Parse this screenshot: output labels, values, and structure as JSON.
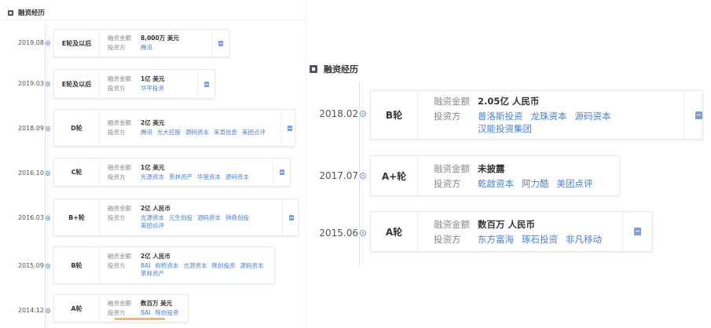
{
  "left": {
    "section_title": "融资经历",
    "rounds": [
      {
        "date": "2019.08",
        "stage": "E轮及以后",
        "amount_label": "融资金额",
        "amount": "8,000万 美元",
        "investor_label": "投资方",
        "investors": [
          "腾讯"
        ]
      },
      {
        "date": "2019.03",
        "stage": "E轮及以后",
        "amount_label": "融资金额",
        "amount": "1亿 美元",
        "investor_label": "投资方",
        "investors": [
          "华平投资"
        ]
      },
      {
        "date": "2018.09",
        "stage": "D轮",
        "amount_label": "融资金额",
        "amount": "2亿 美元",
        "investor_label": "投资方",
        "investors": [
          "腾讯",
          "光大控股",
          "源码资本",
          "来肯信息",
          "美团点评"
        ]
      },
      {
        "date": "2016.10",
        "stage": "C轮",
        "amount_label": "融资金额",
        "amount": "1亿 美元",
        "investor_label": "投资方",
        "investors": [
          "光源资本",
          "景林资产",
          "华登资本",
          "源码资本"
        ]
      },
      {
        "date": "2016.03",
        "stage": "B+轮",
        "amount_label": "融资金额",
        "amount": "2亿 人民币",
        "investor_label": "投资方",
        "investors": [
          "光源资本",
          "元生创投",
          "源码资本",
          "钟鼎创投",
          "美团点评"
        ]
      },
      {
        "date": "2015.09",
        "stage": "B轮",
        "amount_label": "融资金额",
        "amount": "2亿 人民币",
        "investor_label": "投资方",
        "investors": [
          "BAI",
          "树桥资本",
          "光源资本",
          "降创投资",
          "源码资本",
          "景林资产"
        ]
      },
      {
        "date": "2014.12",
        "stage": "A轮",
        "amount_label": "融资金额",
        "amount": "数百万 美元",
        "investor_label": "投资方",
        "investors": [
          "BAI",
          "降创投资"
        ]
      }
    ]
  },
  "right": {
    "section_title": "融资经历",
    "rounds": [
      {
        "date": "2018.02",
        "stage": "B轮",
        "amount_label": "融资金额",
        "amount": "2.05亿 人民币",
        "investor_label": "投资方",
        "investors": [
          "普洛斯投资",
          "龙珠资本",
          "源码资本",
          "汉能投资集团"
        ]
      },
      {
        "date": "2017.07",
        "stage": "A+轮",
        "amount_label": "融资金额",
        "amount": "未披露",
        "investor_label": "投资方",
        "investors": [
          "乾啟资本",
          "阿力酷",
          "美团点评"
        ]
      },
      {
        "date": "2015.06",
        "stage": "A轮",
        "amount_label": "融资金额",
        "amount": "数百万 人民币",
        "investor_label": "投资方",
        "investors": [
          "东方富海",
          "琢石投资",
          "非凡移动"
        ]
      }
    ]
  },
  "icons": {
    "section": "section-icon",
    "document": "document-icon",
    "timeline_dot": "timeline-dot-icon"
  },
  "colors": {
    "link": "#4a7fd1",
    "dot": "#6c93d6",
    "document_icon": "#7f9fd8",
    "accent_bar": "#f5b56a"
  }
}
